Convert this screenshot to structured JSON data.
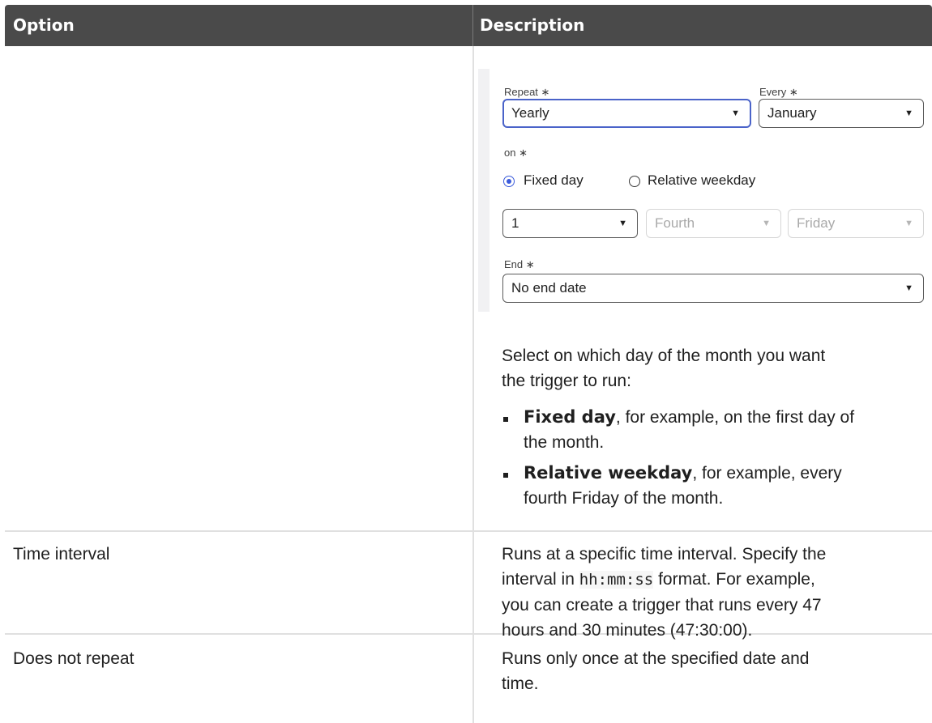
{
  "table": {
    "headers": {
      "option": "Option",
      "description": "Description"
    },
    "form": {
      "repeat_label": "Repeat ∗",
      "repeat_value": "Yearly",
      "every_label": "Every ∗",
      "every_value": "January",
      "on_label": "on ∗",
      "radio_fixed": "Fixed day",
      "radio_relative": "Relative weekday",
      "day_value": "1",
      "ordinal_value": "Fourth",
      "weekday_value": "Friday",
      "end_label": "End ∗",
      "end_value": "No end date"
    },
    "row1": {
      "intro_line1": "Select on which day of the month you want",
      "intro_line2": "the trigger to run:",
      "bullet1_bold": "Fixed day",
      "bullet1_rest": ", for example, on the first day of",
      "bullet1_line2": "the month.",
      "bullet2_bold": "Relative weekday",
      "bullet2_rest": ", for example, every",
      "bullet2_line2": "fourth Friday of the month."
    },
    "row2": {
      "option": "Time interval",
      "line1": "Runs at a specific time interval. Specify the",
      "line2_pre": "interval in ",
      "line2_code": "hh:mm:ss",
      "line2_post": " format. For example,",
      "line3": "you can create a trigger that runs every 47",
      "line4": "hours and 30 minutes (47:30:00)."
    },
    "row3": {
      "option": "Does not repeat",
      "line1": "Runs only once at the specified date and",
      "line2": "time."
    }
  }
}
